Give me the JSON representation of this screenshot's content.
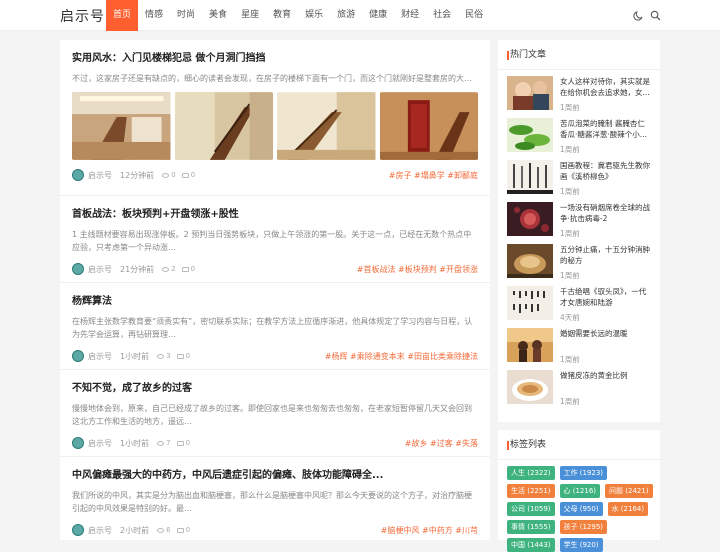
{
  "header": {
    "logo": "启示号",
    "nav": [
      "首页",
      "情感",
      "时尚",
      "美食",
      "星座",
      "教育",
      "娱乐",
      "旅游",
      "健康",
      "财经",
      "社会",
      "民俗"
    ],
    "active_index": 0,
    "icons": [
      "moon-icon",
      "search-icon"
    ]
  },
  "articles": [
    {
      "title": "实用风水：入门见楼梯犯忌 做个月洞门挡挡",
      "desc": "不过，这家房子还是有缺点的，细心的读者会发现，在房子的楼梯下面有一个门，而这个门就刚好是整套房的大...",
      "author": "启示号",
      "time": "12分钟前",
      "views": "0",
      "comments": "0",
      "tags": "#房子 #塌鼻学 #卸鄙庭"
    },
    {
      "title": "首板战法：板块预判+开盘领涨+股性",
      "desc": "1 主线题材要容易出现涨停板。2 预判当日强势板块，只做上午领涨的第一股。关于这一点，已经在无数个热点中应验，只考虑第一个异动涨...",
      "author": "启示号",
      "time": "21分钟前",
      "views": "2",
      "comments": "0",
      "tags": "#首板战法 #板块预判 #开盘领涨"
    },
    {
      "title": "杨辉算法",
      "desc": "在杨辉主张数学教育要“须责实有”，密切联系实际；在教学方法上应循序渐进，他具体规定了学习内容与日程，认为先学会运算，再钻研算理...",
      "author": "启示号",
      "time": "1小时前",
      "views": "3",
      "comments": "0",
      "tags": "#杨辉 #乘除通变本末 #田亩比类乘除捷法"
    },
    {
      "title": "不知不觉，成了故乡的过客",
      "desc": "慢慢地体会到，原来，自己已经成了故乡的过客。即使回家也是来也匆匆去也匆匆，在老家短暂停留几天又会回到这北方工作和生活的地方，遥远...",
      "author": "启示号",
      "time": "1小时前",
      "views": "7",
      "comments": "0",
      "tags": "#故乡 #过客 #失落"
    },
    {
      "title": "中风偏瘫最强大的中药方，中风后遗症引起的偏瘫、肢体功能障碍全...",
      "desc": "我们所说的中风，其实是分为脑出血和脑梗塞，那么什么是脑梗塞中风呢？那么今天要说的这个方子，对治疗脑梗引起的中风效果是特别的好。最...",
      "author": "启示号",
      "time": "2小时前",
      "views": "6",
      "comments": "0",
      "tags": "#脑梗中风 #中药方 #川芎"
    }
  ],
  "hot": {
    "title": "热门文章",
    "items": [
      {
        "title": "女人这样对待你，其实就是在给你机会去追求她，女...",
        "time": "1周前"
      },
      {
        "title": "苦瓜泡菜的腌制 酱腌杏仁香瓜·糖酱洋葱·酸辣个小...",
        "time": "1周前"
      },
      {
        "title": "国画教程：冀君驱先生教你画《溪桥柳色》",
        "time": "1周前"
      },
      {
        "title": "一场没有硝烟席卷全球的战争·抗击病毒-2",
        "time": "1周前"
      },
      {
        "title": "五分钟止痛，十五分钟消肿的秘方",
        "time": "1周前"
      },
      {
        "title": "千古绝唱《驭头凤》，一代才女唐婉和陆游",
        "time": "4天前"
      },
      {
        "title": "婚姻需要长远的温暖",
        "time": "1周前"
      },
      {
        "title": "做猪皮冻的黄金比例",
        "time": "1周前"
      }
    ]
  },
  "tagcloud": {
    "title": "标签列表",
    "tags": [
      {
        "label": "人生 (2322)",
        "color": "#3fb37f"
      },
      {
        "label": "工作 (1923)",
        "color": "#4a90d9"
      },
      {
        "label": "生活 (2251)",
        "color": "#f0803c"
      },
      {
        "label": "心 (1216)",
        "color": "#3fb37f"
      },
      {
        "label": "问题 (2421)",
        "color": "#f0803c"
      },
      {
        "label": "公司 (1059)",
        "color": "#3fb37f"
      },
      {
        "label": "父母 (950)",
        "color": "#4a90d9"
      },
      {
        "label": "水 (2164)",
        "color": "#f0803c"
      },
      {
        "label": "事情 (1555)",
        "color": "#3fb37f"
      },
      {
        "label": "孩子 (1295)",
        "color": "#f0803c"
      },
      {
        "label": "中国 (1443)",
        "color": "#3fb37f"
      },
      {
        "label": "学生 (920)",
        "color": "#4a90d9"
      }
    ]
  },
  "colors": {
    "accent": "#ff5e2e",
    "tag": "#f26b3a"
  }
}
